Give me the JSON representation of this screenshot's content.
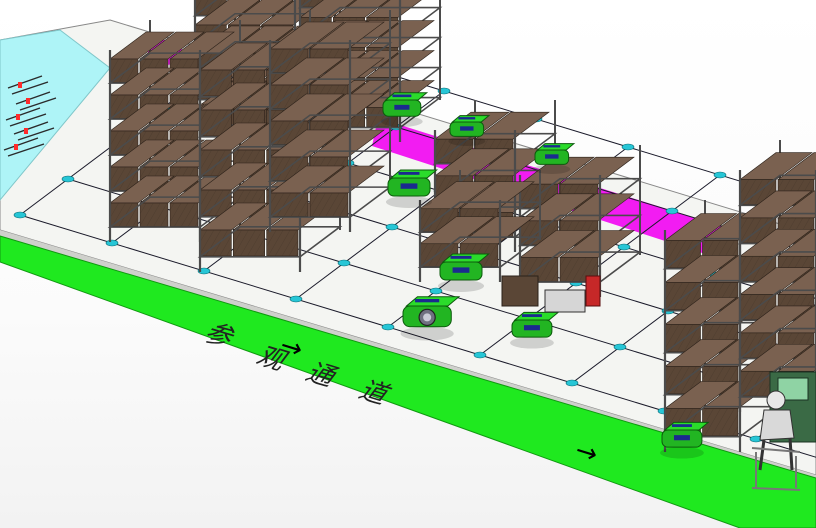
{
  "viewport": {
    "background": "#ffffff",
    "floor_color": "#f4f5f2",
    "grid_line_color": "#1a1a2a",
    "node_marker_color": "#27c6d6"
  },
  "aisle": {
    "color": "#1fe91f",
    "text": "参观通道",
    "arrow_glyph": "→",
    "arrow_color": "#000000"
  },
  "cyan_panel": {
    "color": "#aef4f7",
    "marker_color": "#ff2b2b"
  },
  "magenta_zone": {
    "color": "#f21cf2"
  },
  "shelf": {
    "frame_color": "#4b4b4b",
    "box_color": "#5a4636",
    "box_top_color": "#7a6150"
  },
  "agv": {
    "body_color": "#22b522",
    "top_color": "#2bdc2b",
    "accent_color": "#1b2a8f",
    "lens_color": "#6f7080"
  },
  "operator": {
    "shirt_color": "#d9d9d9",
    "desk_color": "#3a6a45"
  }
}
